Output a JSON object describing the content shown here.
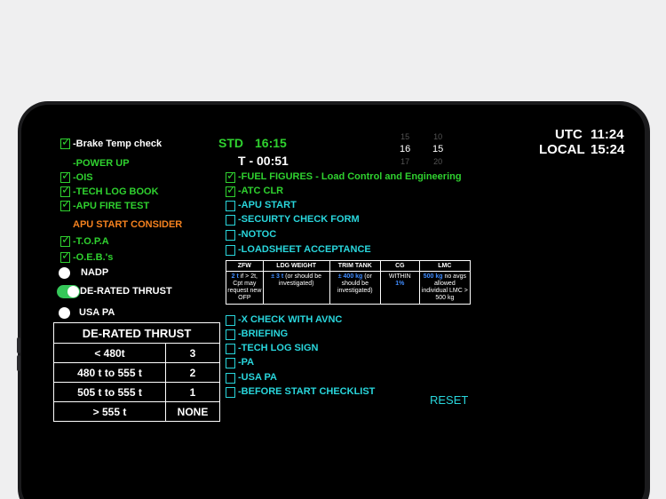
{
  "clock": {
    "utc_label": "UTC",
    "utc_time": "11:24",
    "local_label": "LOCAL",
    "local_time": "15:24"
  },
  "std": {
    "label": "STD",
    "time": "16:15",
    "countdown": "T - 00:51"
  },
  "picker": {
    "hours": [
      "15",
      "16",
      "17"
    ],
    "minutes": [
      "10",
      "15",
      "20"
    ]
  },
  "left_checklist": {
    "brake_temp": "-Brake Temp check",
    "power_up": "-POWER UP",
    "ois": "-OIS",
    "tech_log_book": "-TECH LOG BOOK",
    "apu_fire_test": "-APU FIRE TEST",
    "apu_start_consider": "APU START CONSIDER",
    "topa": "-T.O.P.A",
    "oebs": "-O.E.B.'s"
  },
  "options": {
    "nadp": "NADP",
    "derated_thrust": "DE-RATED THRUST",
    "usa_pa": "USA PA"
  },
  "derate_table": {
    "title": "DE-RATED THRUST",
    "rows": [
      {
        "weight": "< 480t",
        "value": "3"
      },
      {
        "weight": "480 t to 555 t",
        "value": "2"
      },
      {
        "weight": "505 t to 555 t",
        "value": "1"
      },
      {
        "weight": "> 555 t",
        "value": "NONE"
      }
    ]
  },
  "right_checklist": {
    "fuel_figures": "-FUEL FIGURES - Load Control and Engineering",
    "atc_clr": "-ATC CLR",
    "apu_start": "-APU START",
    "security_check": "-SECUIRTY CHECK FORM",
    "notoc": "-NOTOC",
    "loadsheet": "-LOADSHEET ACCEPTANCE",
    "x_check": "-X CHECK WITH AVNC",
    "briefing": "-BRIEFING",
    "tech_log_sign": "-TECH LOG SIGN",
    "pa": "-PA",
    "usa_pa": "-USA PA",
    "before_start": "-BEFORE START CHECKLIST"
  },
  "fuel_table": {
    "headers": [
      "ZFW",
      "LDG WEIGHT",
      "TRIM TANK",
      "CG",
      "LMC"
    ],
    "zfw_hl": "2 t",
    "zfw_text": " if > 2t, Cpt may request new OFP",
    "ldg_hl": "± 3 t",
    "ldg_text": " (or should be investigated)",
    "trim_hl": "± 400 kg",
    "trim_text": " (or should be investigated)",
    "cg_text": "WITHIN",
    "cg_hl": "1%",
    "lmc_hl": "500 kg",
    "lmc_text": " no avgs allowed individual LMC > 500 kg"
  },
  "reset_label": "RESET",
  "colors": {
    "green": "#2fd12f",
    "cyan": "#29d6dc",
    "orange": "#f5821f",
    "blue": "#3f8cff",
    "toggle_on": "#35c759"
  }
}
